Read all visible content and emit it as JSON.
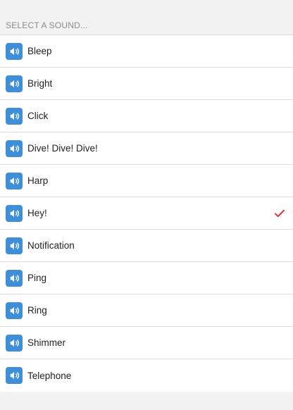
{
  "header": {
    "title": "SELECT A SOUND..."
  },
  "sounds": [
    {
      "label": "Bleep",
      "selected": false
    },
    {
      "label": "Bright",
      "selected": false
    },
    {
      "label": "Click",
      "selected": false
    },
    {
      "label": "Dive! Dive! Dive!",
      "selected": false
    },
    {
      "label": "Harp",
      "selected": false
    },
    {
      "label": "Hey!",
      "selected": true
    },
    {
      "label": "Notification",
      "selected": false
    },
    {
      "label": "Ping",
      "selected": false
    },
    {
      "label": "Ring",
      "selected": false
    },
    {
      "label": "Shimmer",
      "selected": false
    },
    {
      "label": "Telephone",
      "selected": false
    }
  ],
  "icons": {
    "row_icon": "speaker-icon",
    "selected_icon": "checkmark-icon"
  },
  "colors": {
    "icon_bg": "#3f8fd8",
    "check": "#d9363e"
  }
}
